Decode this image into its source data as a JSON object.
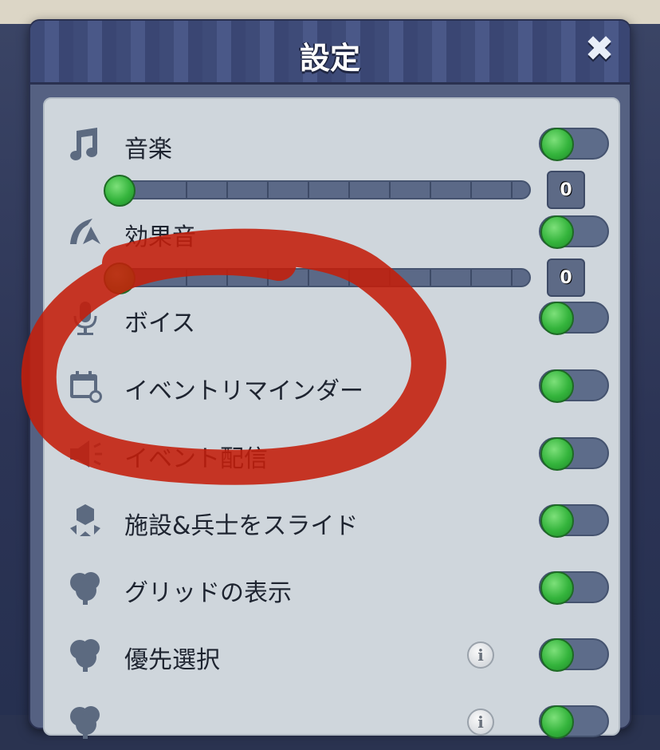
{
  "dialog": {
    "title": "設定",
    "close_label": "✖"
  },
  "settings": [
    {
      "label": "音楽",
      "icon": "music-note-icon",
      "enabled": false
    },
    {
      "label": "効果音",
      "icon": "sound-effect-icon",
      "enabled": false
    },
    {
      "label": "ボイス",
      "icon": "microphone-icon",
      "enabled": false
    },
    {
      "label": "イベントリマインダー",
      "icon": "calendar-icon",
      "enabled": false
    },
    {
      "label": "イベント配信",
      "icon": "megaphone-icon",
      "enabled": false
    },
    {
      "label": "施設&兵士をスライド",
      "icon": "buildings-move-icon",
      "enabled": false
    },
    {
      "label": "グリッドの表示",
      "icon": "tree-icon",
      "enabled": false
    },
    {
      "label": "優先選択",
      "icon": "tree-icon",
      "enabled": false,
      "has_info": true
    },
    {
      "label": "",
      "icon": "tree-icon",
      "enabled": false,
      "has_info": true
    }
  ],
  "music_volume": {
    "value": "0",
    "level": 0
  },
  "sfx_volume": {
    "value": "0",
    "level": 0
  },
  "info_label": "i",
  "colors": {
    "toggle_knob": "#34b43c",
    "panel_bg": "#cfd6dc",
    "header_bg": "#3e4b78",
    "annotation_red": "#c41e0a"
  }
}
